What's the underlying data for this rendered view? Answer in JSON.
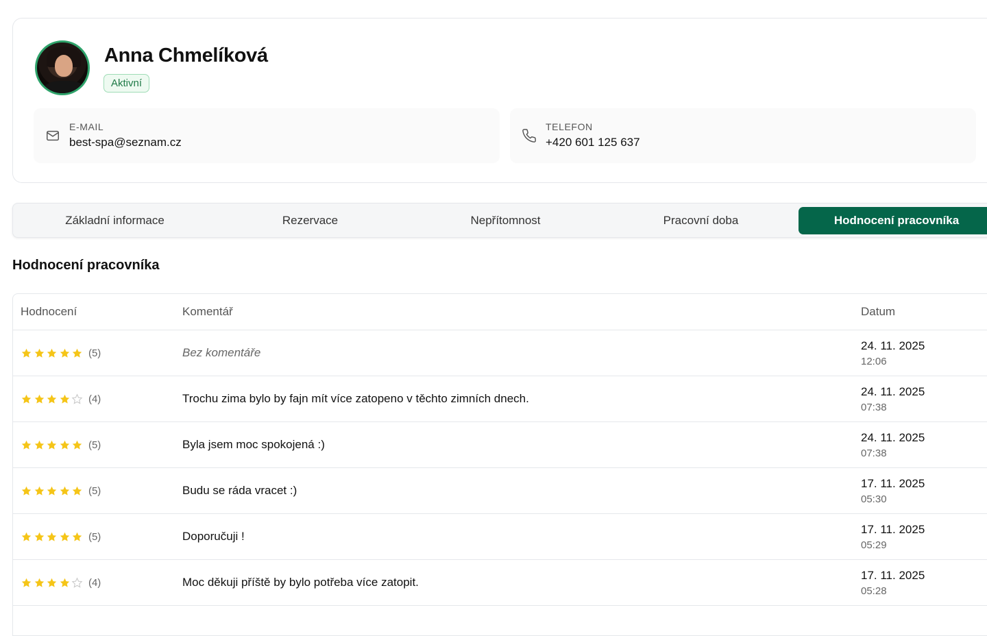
{
  "profile": {
    "name": "Anna Chmelíková",
    "status": "Aktivní",
    "email_label": "E-MAIL",
    "email": "best-spa@seznam.cz",
    "phone_label": "TELEFON",
    "phone": "+420 601 125 637"
  },
  "tabs": [
    {
      "label": "Základní informace",
      "active": false
    },
    {
      "label": "Rezervace",
      "active": false
    },
    {
      "label": "Nepřítomnost",
      "active": false
    },
    {
      "label": "Pracovní doba",
      "active": false
    },
    {
      "label": "Hodnocení pracovníka",
      "active": true
    }
  ],
  "section_title": "Hodnocení pracovníka",
  "table": {
    "headers": {
      "rating": "Hodnocení",
      "comment": "Komentář",
      "date": "Datum"
    },
    "rows": [
      {
        "rating": 5,
        "rating_label": "(5)",
        "comment": "Bez komentáře",
        "empty": true,
        "date": "24. 11. 2025",
        "time": "12:06"
      },
      {
        "rating": 4,
        "rating_label": "(4)",
        "comment": "Trochu zima bylo by fajn mít více zatopeno v těchto zimních dnech.",
        "empty": false,
        "date": "24. 11. 2025",
        "time": "07:38"
      },
      {
        "rating": 5,
        "rating_label": "(5)",
        "comment": "Byla jsem moc spokojená :)",
        "empty": false,
        "date": "24. 11. 2025",
        "time": "07:38"
      },
      {
        "rating": 5,
        "rating_label": "(5)",
        "comment": "Budu se ráda vracet :)",
        "empty": false,
        "date": "17. 11. 2025",
        "time": "05:30"
      },
      {
        "rating": 5,
        "rating_label": "(5)",
        "comment": "Doporučuji !",
        "empty": false,
        "date": "17. 11. 2025",
        "time": "05:29"
      },
      {
        "rating": 4,
        "rating_label": "(4)",
        "comment": "Moc děkuji příště by bylo potřeba více zatopit.",
        "empty": false,
        "date": "17. 11. 2025",
        "time": "05:28"
      }
    ]
  },
  "colors": {
    "accent": "#05664a",
    "star_filled": "#f5c518",
    "star_empty": "#c8c8c8",
    "avatar_ring": "#2fa36b"
  },
  "icons": {
    "email": "mail-icon",
    "phone": "phone-icon",
    "star": "star-icon"
  }
}
